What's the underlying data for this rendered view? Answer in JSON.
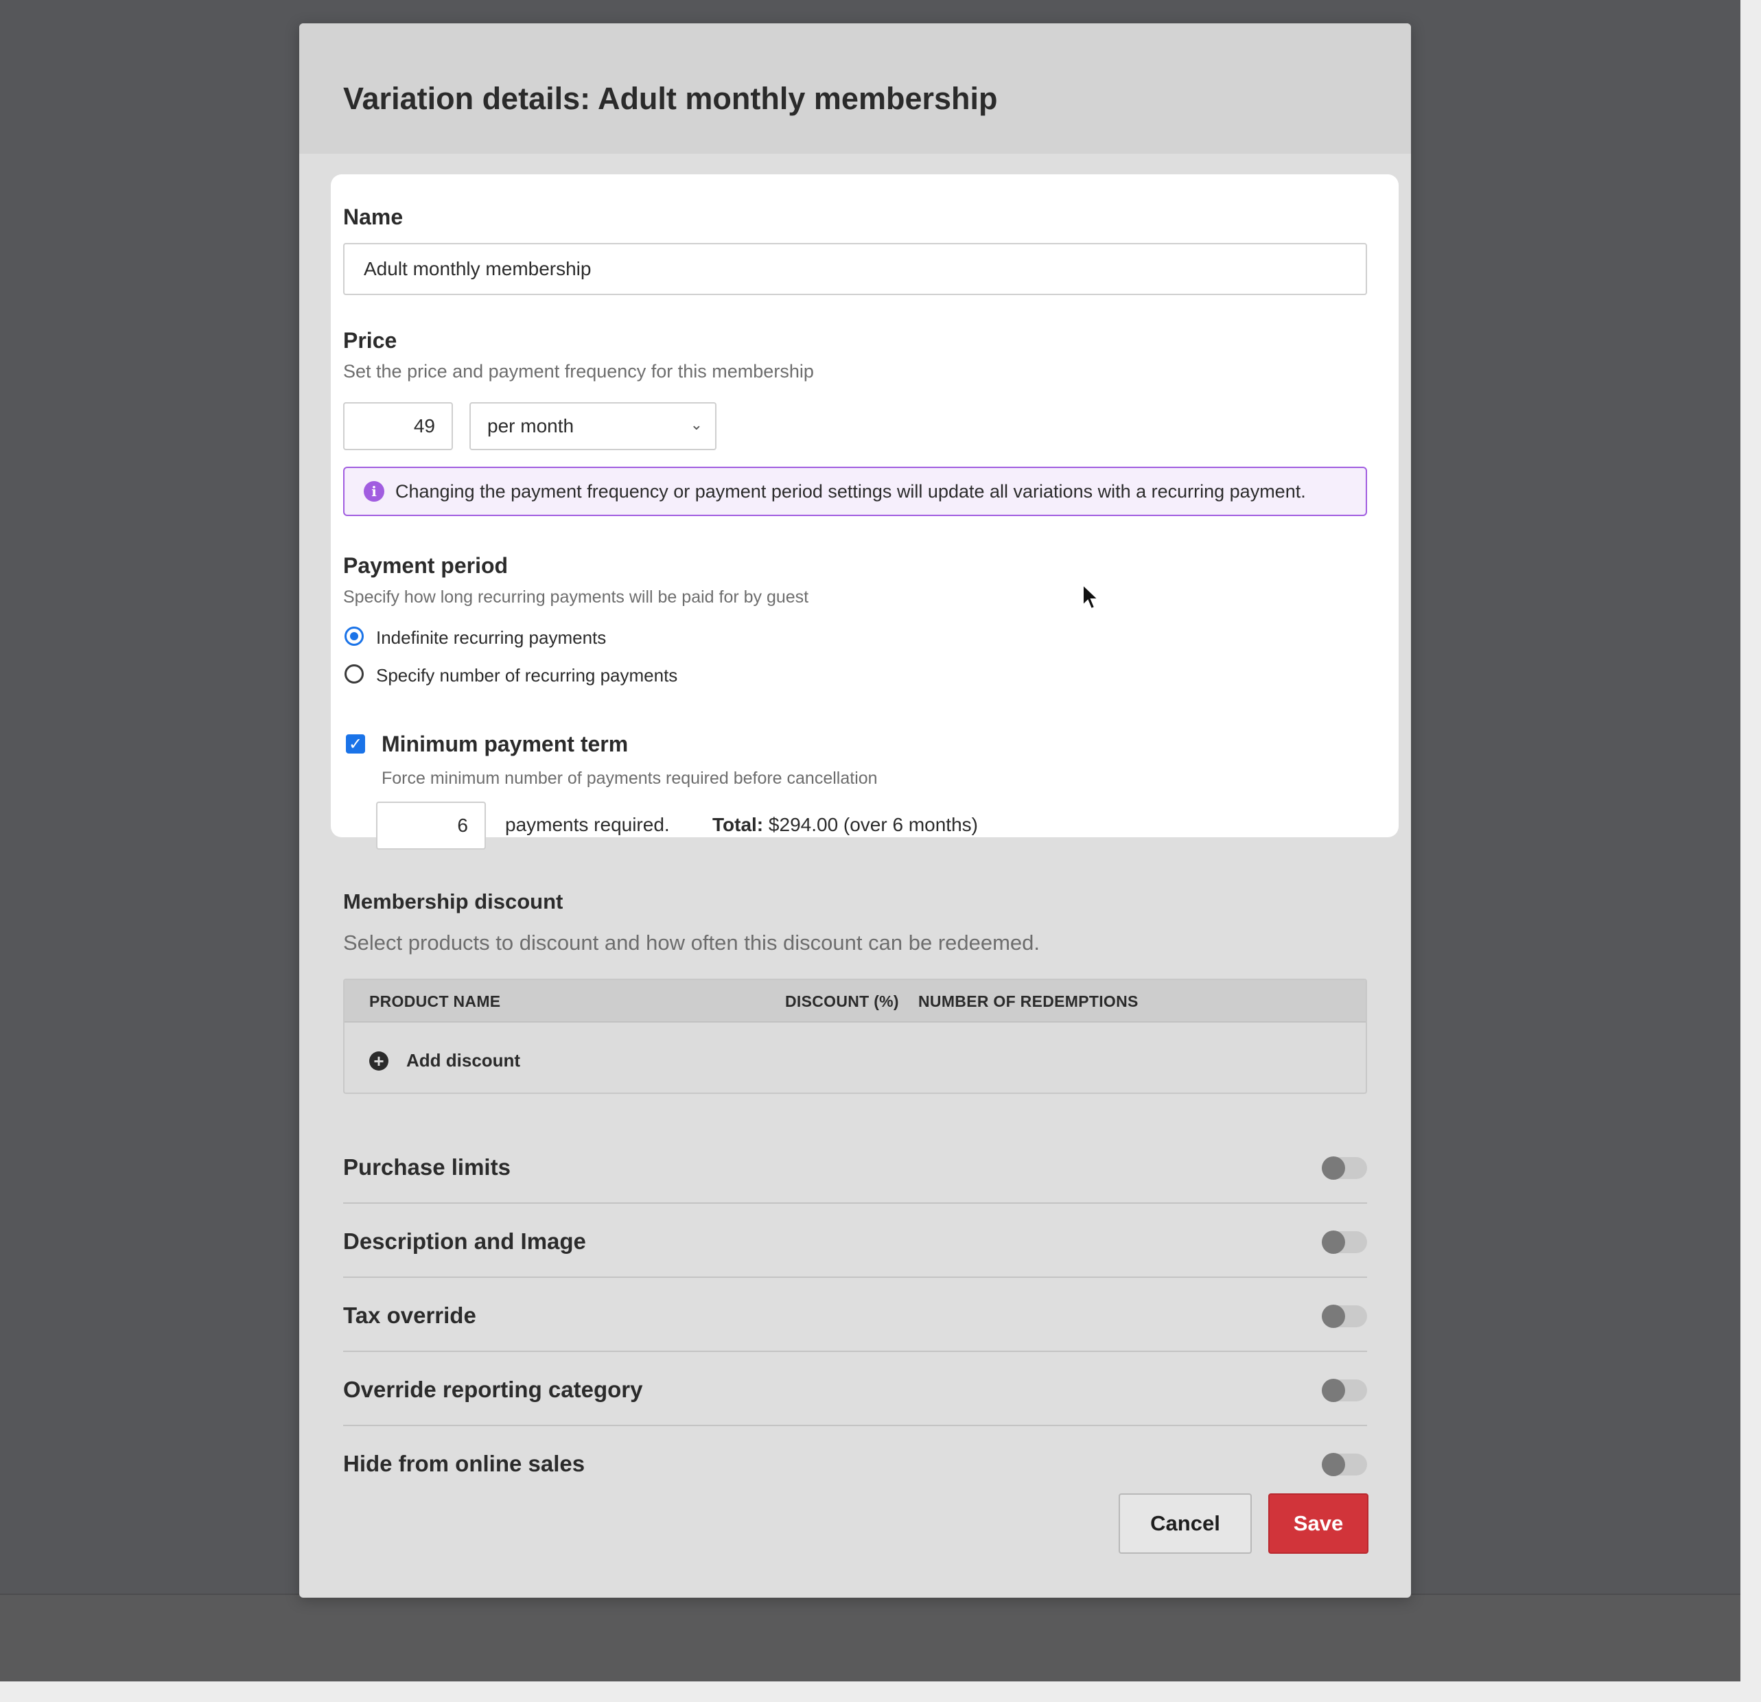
{
  "modal": {
    "title": "Variation details: Adult monthly membership"
  },
  "name_section": {
    "label": "Name",
    "value": "Adult monthly membership"
  },
  "price_section": {
    "label": "Price",
    "help": "Set the price and payment frequency for this membership",
    "amount": "49",
    "frequency": "per month",
    "info_text": "Changing the payment frequency or payment period settings will update all variations with a recurring payment."
  },
  "payment_period": {
    "label": "Payment period",
    "help": "Specify how long recurring payments will be paid for by guest",
    "options": [
      {
        "label": "Indefinite recurring payments",
        "selected": true
      },
      {
        "label": "Specify number of recurring payments",
        "selected": false
      }
    ]
  },
  "minimum_term": {
    "checked": true,
    "label": "Minimum payment term",
    "help": "Force minimum number of payments required before cancellation",
    "count": "6",
    "suffix": "payments required.",
    "total_label": "Total:",
    "total_value": "$294.00 (over 6 months)"
  },
  "discount": {
    "label": "Membership discount",
    "help": "Select products to discount and how often this discount can be redeemed.",
    "columns": [
      "PRODUCT NAME",
      "DISCOUNT (%)",
      "NUMBER OF REDEMPTIONS"
    ],
    "add_label": "Add discount"
  },
  "toggles": [
    {
      "label": "Purchase limits",
      "on": false
    },
    {
      "label": "Description and Image",
      "on": false
    },
    {
      "label": "Tax override",
      "on": false
    },
    {
      "label": "Override reporting category",
      "on": false
    },
    {
      "label": "Hide from online sales",
      "on": false
    }
  ],
  "actions": {
    "cancel": "Cancel",
    "save": "Save"
  },
  "colors": {
    "accent": "#1a73e8",
    "info_border": "#a15de0",
    "save": "#d1343a"
  }
}
